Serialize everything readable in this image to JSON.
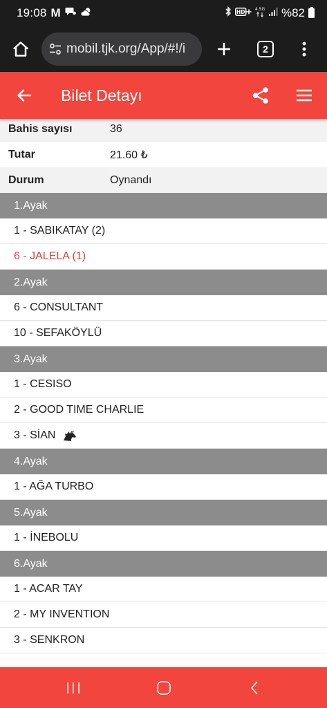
{
  "status_bar": {
    "time": "19:08",
    "app_icon": "M",
    "battery_text": "%82",
    "icons": [
      "gmail-icon",
      "chat-icon",
      "weather-icon",
      "bluetooth-icon",
      "hd-plus-icon",
      "data-4g-icon",
      "signal-icon",
      "battery-icon"
    ]
  },
  "browser": {
    "url": "mobil.tjk.org/App/#!/i",
    "tab_count": "2"
  },
  "header": {
    "title": "Bilet Detayı",
    "color": "#f1453d"
  },
  "summary": [
    {
      "label": "Bahis sayısı",
      "value": "36"
    },
    {
      "label": "Tutar",
      "value": "21.60 ₺"
    },
    {
      "label": "Durum",
      "value": "Oynandı"
    }
  ],
  "legs": [
    {
      "title": "1.Ayak",
      "horses": [
        {
          "text": "1 - SABIKATAY (2)"
        },
        {
          "text": "6 - JALELA (1)",
          "highlight": true
        }
      ]
    },
    {
      "title": "2.Ayak",
      "horses": [
        {
          "text": "6 - CONSULTANT"
        },
        {
          "text": "10 - SEFAKÖYLÜ"
        }
      ]
    },
    {
      "title": "3.Ayak",
      "horses": [
        {
          "text": "1 - CESISO"
        },
        {
          "text": "2 - GOOD TIME CHARLIE"
        },
        {
          "text": "3 - SİAN",
          "icon": "horse-head-icon"
        }
      ]
    },
    {
      "title": "4.Ayak",
      "horses": [
        {
          "text": "1 - AĞA TURBO"
        }
      ]
    },
    {
      "title": "5.Ayak",
      "horses": [
        {
          "text": "1 - İNEBOLU"
        }
      ]
    },
    {
      "title": "6.Ayak",
      "horses": [
        {
          "text": "1 - ACAR TAY"
        },
        {
          "text": "2 - MY INVENTION"
        },
        {
          "text": "3 - SENKRON"
        }
      ]
    }
  ],
  "colors": {
    "accent": "#f1453d",
    "leg_header": "#8c8c8c",
    "highlight_text": "#e0433b"
  }
}
